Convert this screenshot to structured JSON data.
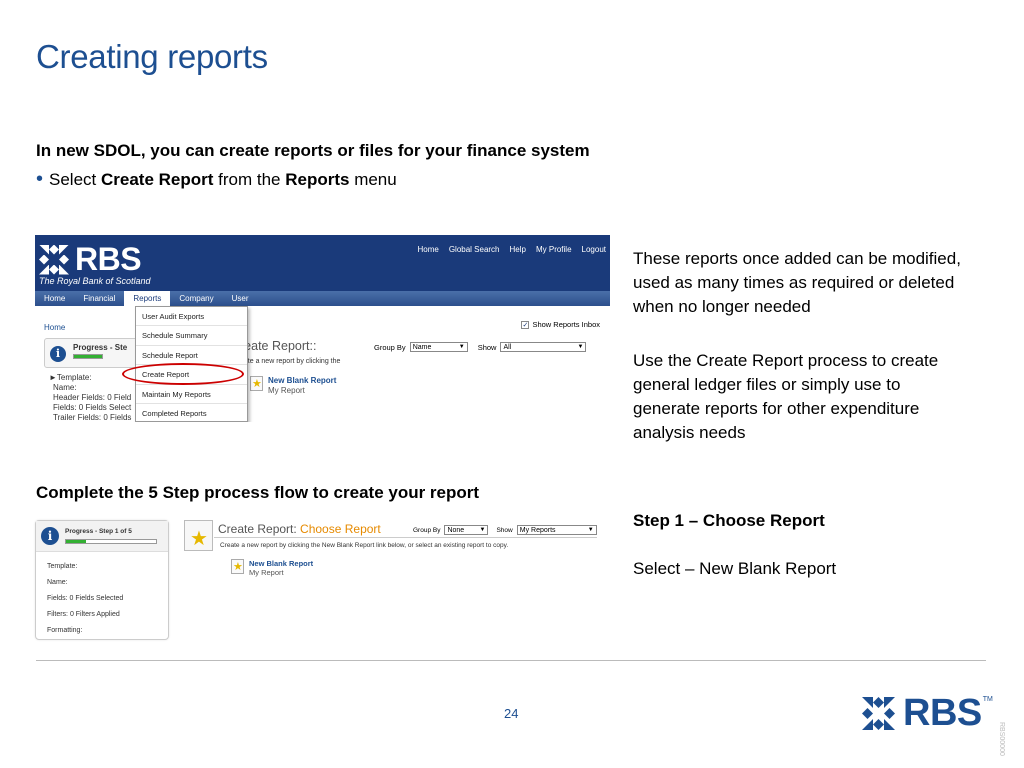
{
  "slide": {
    "title": "Creating reports",
    "intro": "In new SDOL, you can create reports or files for your finance system",
    "bullet_pre": "Select ",
    "bullet_b1": "Create Report",
    "bullet_mid": " from the ",
    "bullet_b2": "Reports",
    "bullet_post": " menu",
    "bullet_symbol": "•",
    "right_para1": "These reports once added can be modified, used as many times as required or deleted when no longer needed",
    "right_para2": "Use the Create Report process to create general ledger files or simply use to generate reports for other expenditure analysis needs",
    "complete_heading": "Complete the 5 Step process flow to create your report",
    "step_heading": "Step 1 – Choose Report",
    "step_instruction": "Select – New Blank Report",
    "page_number": "24",
    "footer_logo_text": "RBS",
    "footer_tm": "TM",
    "vertical_code": "RBS00000"
  },
  "screenshot1": {
    "logo_text": "RBS",
    "logo_sub": "The Royal Bank of Scotland",
    "top_links": [
      "Home",
      "Global Search",
      "Help",
      "My Profile",
      "Logout"
    ],
    "nav": [
      "Home",
      "Financial",
      "Reports",
      "Company",
      "User"
    ],
    "nav_active": "Reports",
    "breadcrumb": "Home",
    "show_inbox": "Show Reports Inbox",
    "create_title": "reate Report::",
    "create_desc": "eate a new report by clicking the",
    "group_by_label": "Group By",
    "group_by_value": "Name",
    "show_label": "Show",
    "show_value": "All",
    "progress_text": "Progress - Ste",
    "template_lines": [
      "►Template:",
      "Name:",
      "Header Fields: 0 Field",
      "Fields: 0 Fields Select",
      "Trailer Fields: 0 Fields"
    ],
    "new_blank_link": "New Blank Report",
    "my_report": "My Report",
    "menu_items": [
      "User Audit Exports",
      "Schedule Summary",
      "Schedule Report",
      "Create Report",
      "Maintain My Reports",
      "Completed Reports"
    ]
  },
  "screenshot2": {
    "progress_text": "Progress - Step 1 of 5",
    "lines": [
      "Template:",
      "Name:",
      "Fields: 0 Fields Selected",
      "Filters: 0 Filters Applied",
      "Formatting:"
    ],
    "title_prefix": "Create Report: ",
    "title_highlight": "Choose Report",
    "group_by_label": "Group By",
    "group_by_value": "None",
    "show_label": "Show",
    "show_value": "My Reports",
    "desc": "Create a new report by clicking the New Blank Report link below, or select an existing report to copy.",
    "new_blank_link": "New Blank Report",
    "my_report": "My Report"
  },
  "colors": {
    "title_blue": "#1d4f91",
    "banner_navy": "#1a3a7a",
    "highlight_red": "#cc0000",
    "progress_green": "#33b033",
    "accent_orange": "#e68a00"
  }
}
